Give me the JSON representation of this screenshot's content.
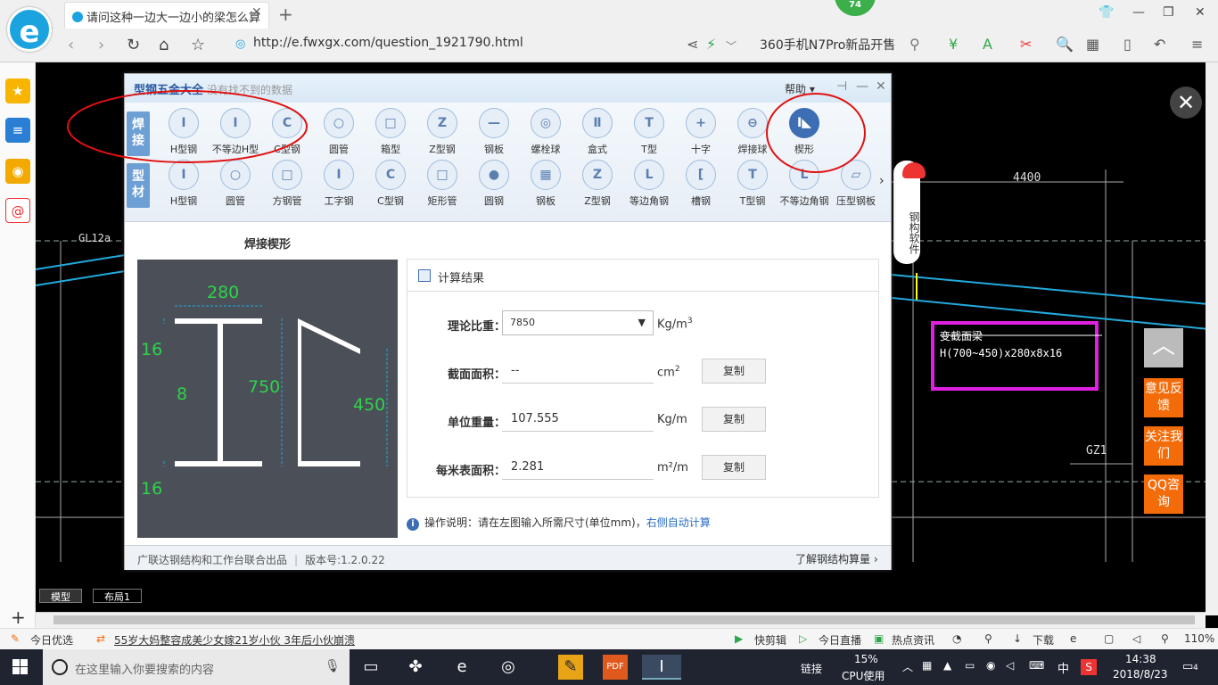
{
  "browser": {
    "tab_title": "请问这种一边大一边小的梁怎么算",
    "badge": "74",
    "url_scheme": "http://",
    "url_rest": "e.fwxgx.com/question_1921790.html",
    "search_text": "360手机N7Pro新品开售",
    "tab_close": "✕",
    "new_tab": "+"
  },
  "cad": {
    "labels": {
      "gl": "GL12a",
      "d4400": "4400",
      "gz1": "GZ1",
      "var_title": "变截面梁",
      "var_spec": "H(700~450)x280x8x16"
    },
    "tabs": [
      "模型",
      "布局1"
    ],
    "close": "✕"
  },
  "right_float": {
    "top": "︿",
    "feedback": "意见反馈",
    "follow": "关注我们",
    "qq": "QQ咨询"
  },
  "mascot": "钢构软件",
  "dialog": {
    "title": "型钢五金大全",
    "subtitle": "没有找不到的数据",
    "help": "帮助 ▾",
    "row1_label": "焊接",
    "row2_label": "型材",
    "row1": [
      {
        "label": "H型钢",
        "glyph": "I"
      },
      {
        "label": "不等边H型",
        "glyph": "I"
      },
      {
        "label": "C型钢",
        "glyph": "C"
      },
      {
        "label": "圆管",
        "glyph": "○"
      },
      {
        "label": "箱型",
        "glyph": "□"
      },
      {
        "label": "Z型钢",
        "glyph": "Z"
      },
      {
        "label": "钢板",
        "glyph": "—"
      },
      {
        "label": "螺栓球",
        "glyph": "◎"
      },
      {
        "label": "盒式",
        "glyph": "Ⅱ"
      },
      {
        "label": "T型",
        "glyph": "T"
      },
      {
        "label": "十字",
        "glyph": "+"
      },
      {
        "label": "焊接球",
        "glyph": "⊖"
      },
      {
        "label": "楔形",
        "glyph": "I◣"
      }
    ],
    "row2": [
      {
        "label": "H型钢",
        "glyph": "I"
      },
      {
        "label": "圆管",
        "glyph": "○"
      },
      {
        "label": "方钢管",
        "glyph": "□"
      },
      {
        "label": "工字钢",
        "glyph": "I"
      },
      {
        "label": "C型钢",
        "glyph": "C"
      },
      {
        "label": "矩形管",
        "glyph": "□"
      },
      {
        "label": "圆钢",
        "glyph": "●"
      },
      {
        "label": "钢板",
        "glyph": "▦"
      },
      {
        "label": "Z型钢",
        "glyph": "Z"
      },
      {
        "label": "等边角钢",
        "glyph": "L"
      },
      {
        "label": "槽钢",
        "glyph": "["
      },
      {
        "label": "T型钢",
        "glyph": "T"
      },
      {
        "label": "不等边角钢",
        "glyph": "L"
      },
      {
        "label": "压型钢板",
        "glyph": "▱"
      }
    ],
    "figure_title": "焊接楔形",
    "dims": {
      "width": "280",
      "t_top": "16",
      "web": "8",
      "h_left": "750",
      "h_right": "450",
      "t_bot": "16"
    },
    "result_title": "计算结果",
    "fields": {
      "density_label": "理论比重：",
      "density_value": "7850",
      "density_unit": "Kg/m",
      "density_sup": "3",
      "area_label": "截面面积：",
      "area_value": "--",
      "area_unit": "cm",
      "area_sup": "2",
      "weight_label": "单位重量：",
      "weight_value": "107.555",
      "weight_unit": "Kg/m",
      "surface_label": "每米表面积：",
      "surface_value": "2.281",
      "surface_unit": "m²/m"
    },
    "copy": "复制",
    "tip_prefix": "操作说明：请在左图输入所需尺寸(单位mm)，",
    "tip_link": "右侧自动计算",
    "footer_left": "广联达钢结构和工作台联合出品",
    "footer_version": "版本号:1.2.0.22",
    "footer_right": "了解钢结构算量 ›"
  },
  "status": {
    "today": "今日优选",
    "news": "55岁大妈整容成美少女嫁21岁小伙 3年后小伙崩溃",
    "cut": "快剪辑",
    "live": "今日直播",
    "hot": "热点资讯",
    "download": "下载",
    "zoom": "110%"
  },
  "taskbar": {
    "search": "在这里输入你要搜索的内容",
    "link": "链接",
    "cpu_pct": "15%",
    "cpu_label": "CPU使用",
    "ime": "中",
    "time": "14:38",
    "date": "2018/8/23",
    "notif": "4"
  }
}
